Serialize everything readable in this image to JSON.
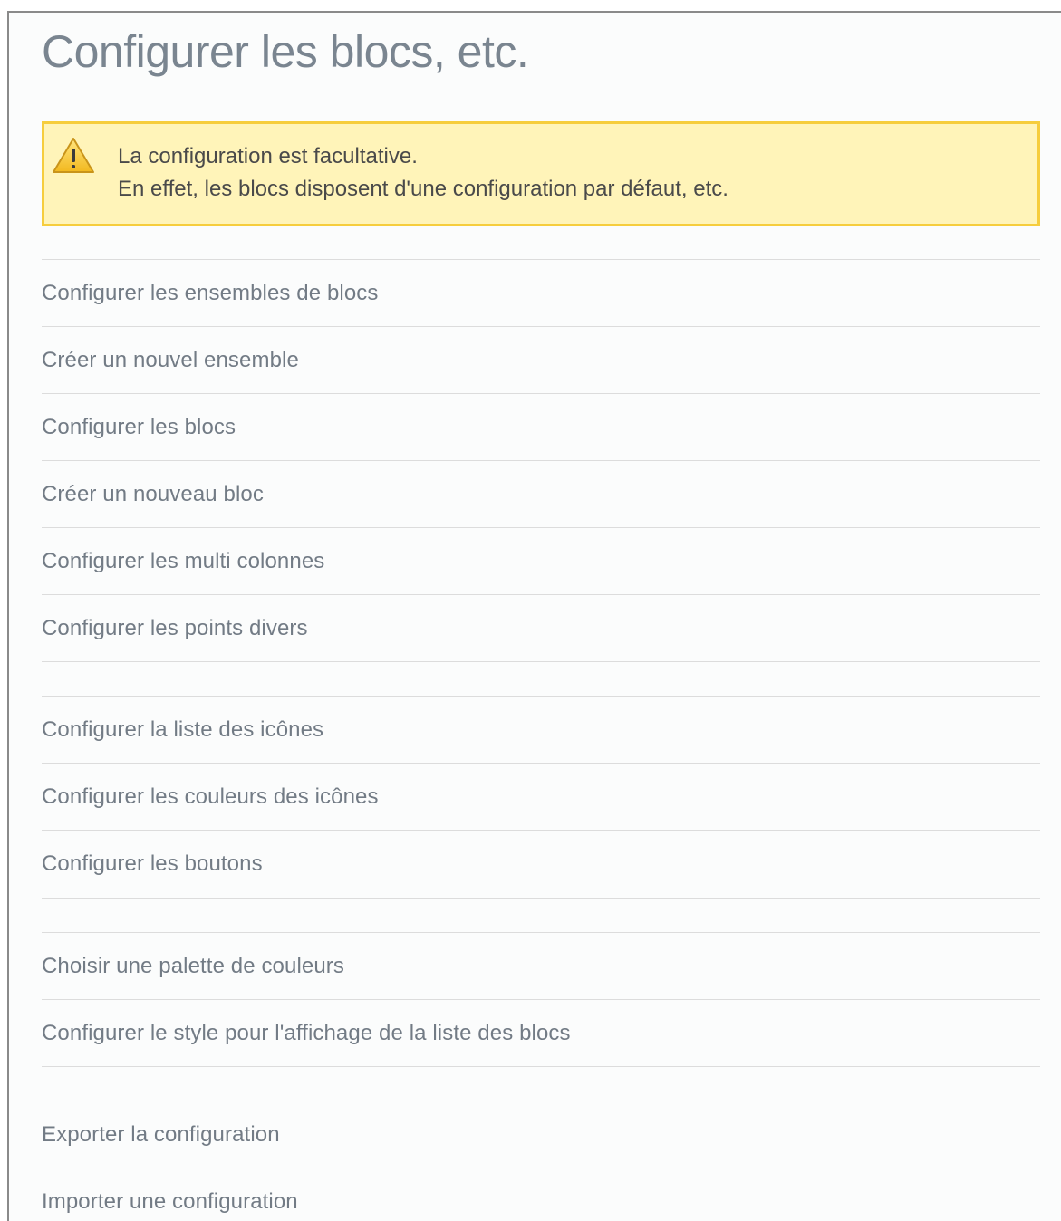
{
  "page_title": "Configurer les blocs, etc.",
  "warning": {
    "icon": "warning-triangle-icon",
    "line1": "La configuration est facultative.",
    "line2": "En effet, les blocs disposent d'une configuration par défaut, etc."
  },
  "groups": [
    {
      "links": [
        "Configurer les ensembles de blocs",
        "Créer un nouvel ensemble",
        "Configurer les blocs",
        "Créer un nouveau bloc",
        "Configurer les multi colonnes",
        "Configurer les points divers"
      ]
    },
    {
      "links": [
        "Configurer la liste des icônes",
        "Configurer les couleurs des icônes",
        "Configurer les boutons"
      ]
    },
    {
      "links": [
        "Choisir une palette de couleurs",
        "Configurer le style pour l'affichage de la liste des blocs"
      ]
    },
    {
      "links": [
        "Exporter la configuration",
        "Importer une configuration"
      ]
    }
  ],
  "colors": {
    "title": "#7a8590",
    "link": "#727b85",
    "warning_bg": "#fff4b9",
    "warning_border": "#f6cd3d",
    "divider": "#dcdcdc"
  }
}
